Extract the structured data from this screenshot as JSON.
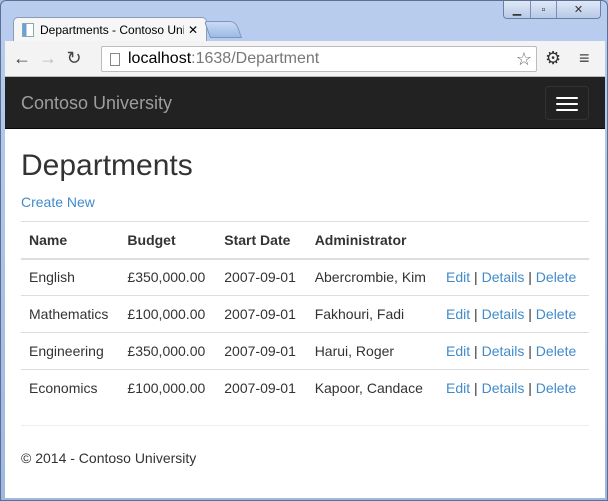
{
  "browser": {
    "tab_title": "Departments - Contoso University",
    "url_host": "localhost",
    "url_path": ":1638/Department",
    "window_controls": [
      "minimize",
      "maximize",
      "close"
    ]
  },
  "navbar": {
    "brand": "Contoso University"
  },
  "main": {
    "title": "Departments",
    "create_link": "Create New",
    "columns": [
      "Name",
      "Budget",
      "Start Date",
      "Administrator",
      ""
    ],
    "rows": [
      {
        "name": "English",
        "budget": "£350,000.00",
        "start": "2007-09-01",
        "admin": "Abercrombie, Kim"
      },
      {
        "name": "Mathematics",
        "budget": "£100,000.00",
        "start": "2007-09-01",
        "admin": "Fakhouri, Fadi"
      },
      {
        "name": "Engineering",
        "budget": "£350,000.00",
        "start": "2007-09-01",
        "admin": "Harui, Roger"
      },
      {
        "name": "Economics",
        "budget": "£100,000.00",
        "start": "2007-09-01",
        "admin": "Kapoor, Candace"
      }
    ],
    "actions": {
      "edit": "Edit",
      "details": "Details",
      "delete": "Delete",
      "sep": "|"
    }
  },
  "footer": {
    "text": "© 2014 - Contoso University"
  }
}
